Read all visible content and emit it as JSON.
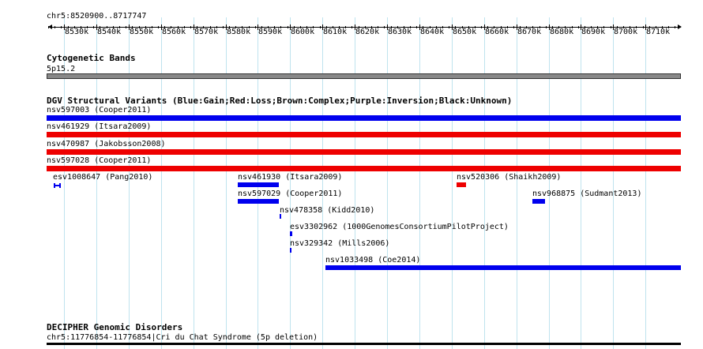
{
  "ruler": {
    "range_label": "chr5:8520900..8717747",
    "ticks": [
      "8530k",
      "8540k",
      "8550k",
      "8560k",
      "8570k",
      "8580k",
      "8590k",
      "8600k",
      "8610k",
      "8620k",
      "8630k",
      "8640k",
      "8650k",
      "8660k",
      "8670k",
      "8680k",
      "8690k",
      "8700k",
      "8710k"
    ]
  },
  "cytobands": {
    "title": "Cytogenetic Bands",
    "band_label": "5p15.2",
    "band_color": "#888888"
  },
  "dgv": {
    "title": "DGV Structural Variants (Blue:Gain;Red:Loss;Brown:Complex;Purple:Inversion;Black:Unknown)",
    "colors": {
      "gain": "#0000ee",
      "loss": "#ee0000"
    },
    "features": [
      {
        "label": "nsv597003 (Cooper2011)",
        "type": "gain"
      },
      {
        "label": "nsv461929 (Itsara2009)",
        "type": "loss"
      },
      {
        "label": "nsv470987 (Jakobsson2008)",
        "type": "loss"
      },
      {
        "label": "nsv597028 (Cooper2011)",
        "type": "loss"
      },
      {
        "label": "esv1008647 (Pang2010)",
        "type": "gain"
      },
      {
        "label": "nsv461930 (Itsara2009)",
        "type": "gain"
      },
      {
        "label": "nsv520306 (Shaikh2009)",
        "type": "loss"
      },
      {
        "label": "nsv597029 (Cooper2011)",
        "type": "gain"
      },
      {
        "label": "nsv968875 (Sudmant2013)",
        "type": "gain"
      },
      {
        "label": "nsv478358 (Kidd2010)",
        "type": "gain"
      },
      {
        "label": "esv3302962 (1000GenomesConsortiumPilotProject)",
        "type": "gain"
      },
      {
        "label": "nsv329342 (Mills2006)",
        "type": "gain"
      },
      {
        "label": "nsv1033498 (Coe2014)",
        "type": "gain"
      }
    ]
  },
  "decipher": {
    "title": "DECIPHER Genomic Disorders",
    "feature_label": "chr5:11776854-11776854|Cri du Chat Syndrome (5p deletion)"
  }
}
